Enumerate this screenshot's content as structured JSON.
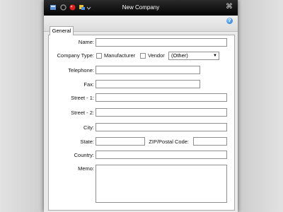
{
  "window": {
    "title": "New Company",
    "close_glyph": "⌘"
  },
  "toolbar_icons": [
    "back-icon",
    "refresh-icon",
    "record-icon",
    "tools-icon",
    "dropdown-icon"
  ],
  "help": {
    "glyph": "?"
  },
  "tab": {
    "label": "General"
  },
  "form": {
    "name_label": "Name:",
    "company_type_label": "Company Type:",
    "manufacturer_label": "Manufacturer",
    "vendor_label": "Vendor",
    "type_select_value": "(Other)",
    "telephone_label": "Telephone:",
    "fax_label": "Fax:",
    "street1_label": "Street - 1:",
    "street2_label": "Street - 2:",
    "city_label": "City:",
    "state_label": "State:",
    "zip_label": "ZIP/Postal Code:",
    "country_label": "Country:",
    "memo_label": "Memo:"
  },
  "colors": {
    "titlebar": "#0a0a0a",
    "help_icon": "#1d6fd0",
    "window_bg": "#eaeaea"
  }
}
